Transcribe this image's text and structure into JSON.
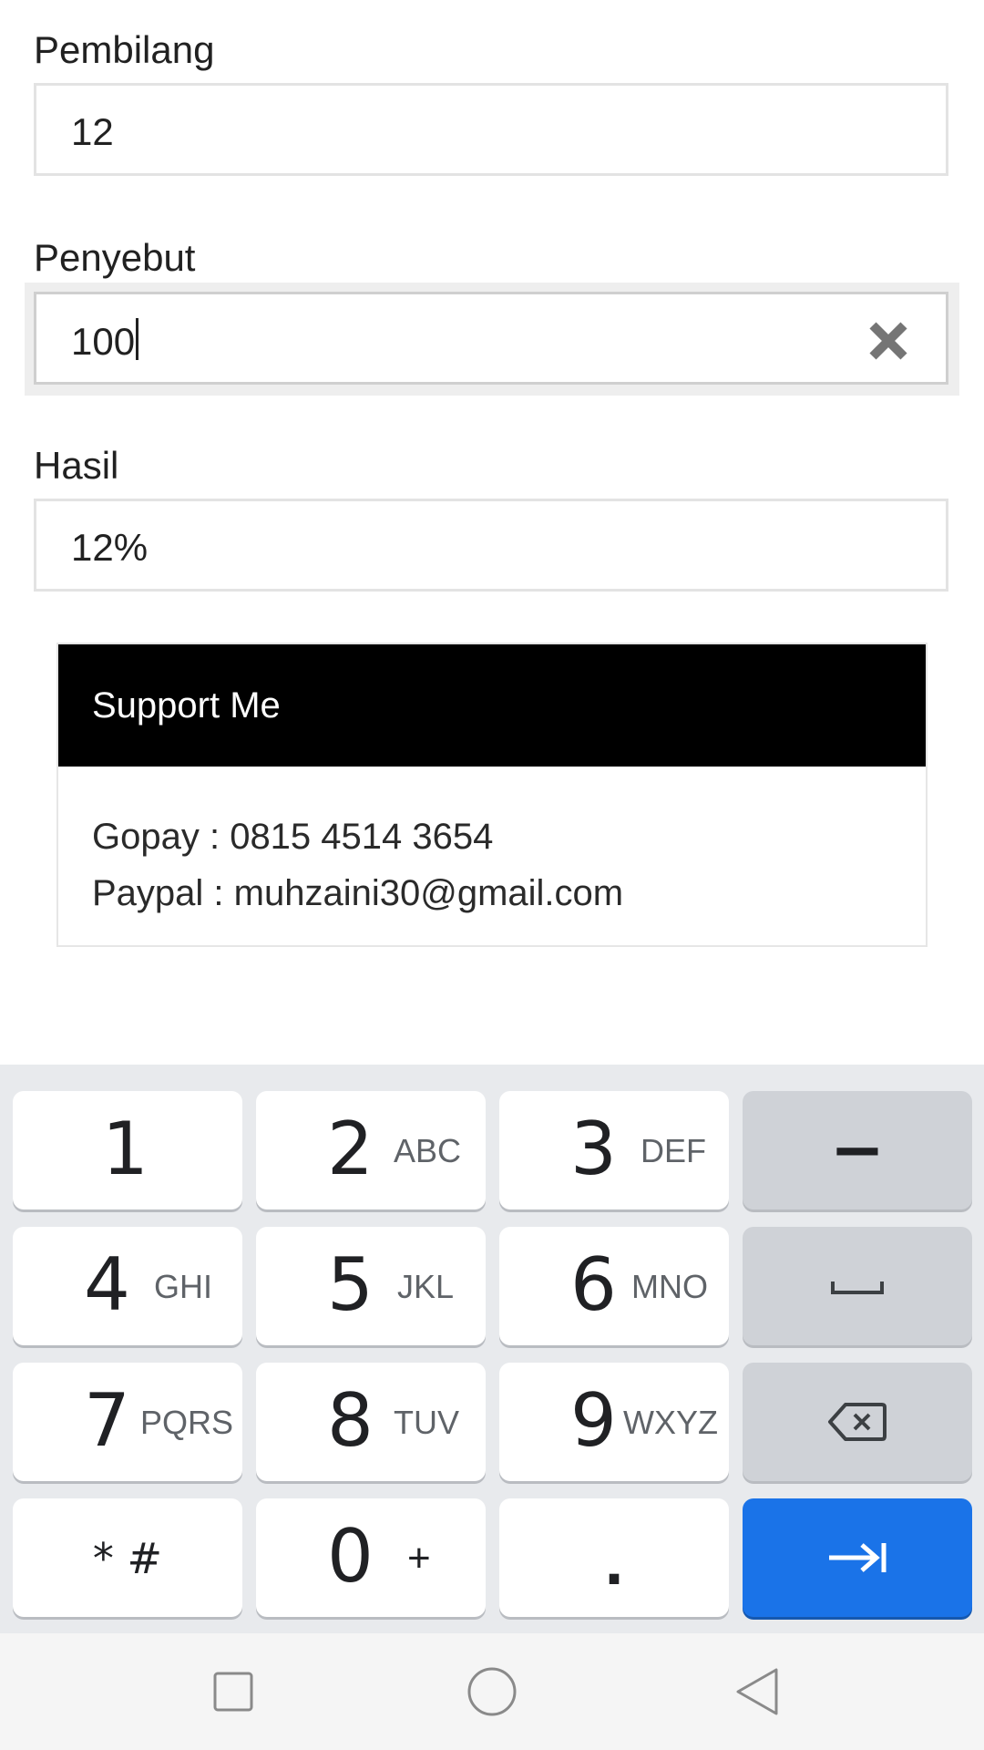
{
  "form": {
    "numerator": {
      "label": "Pembilang",
      "value": "12"
    },
    "denominator": {
      "label": "Penyebut",
      "value": "100"
    },
    "result": {
      "label": "Hasil",
      "value": "12%"
    }
  },
  "support_card": {
    "title": "Support Me",
    "lines": [
      "Gopay : 0815 4514 3654",
      "Paypal : muhzaini30@gmail.com"
    ]
  },
  "keyboard": {
    "keys": [
      {
        "digit": "1",
        "letters": ""
      },
      {
        "digit": "2",
        "letters": "ABC"
      },
      {
        "digit": "3",
        "letters": "DEF"
      },
      {
        "digit": "4",
        "letters": "GHI"
      },
      {
        "digit": "5",
        "letters": "JKL"
      },
      {
        "digit": "6",
        "letters": "MNO"
      },
      {
        "digit": "7",
        "letters": "PQRS"
      },
      {
        "digit": "8",
        "letters": "TUV"
      },
      {
        "digit": "9",
        "letters": "WXYZ"
      },
      {
        "digit": "0",
        "letters": "+"
      }
    ],
    "minus": "−",
    "star_hash": "* #",
    "dot": ".",
    "icons": {
      "space": "space-bar-icon",
      "backspace": "backspace-icon",
      "next": "tab-next-icon"
    },
    "colors": {
      "action": "#1a73e8",
      "background": "#e8eaed"
    }
  },
  "navbar": {
    "icons": [
      "recents-square-icon",
      "home-circle-icon",
      "back-triangle-icon"
    ]
  }
}
